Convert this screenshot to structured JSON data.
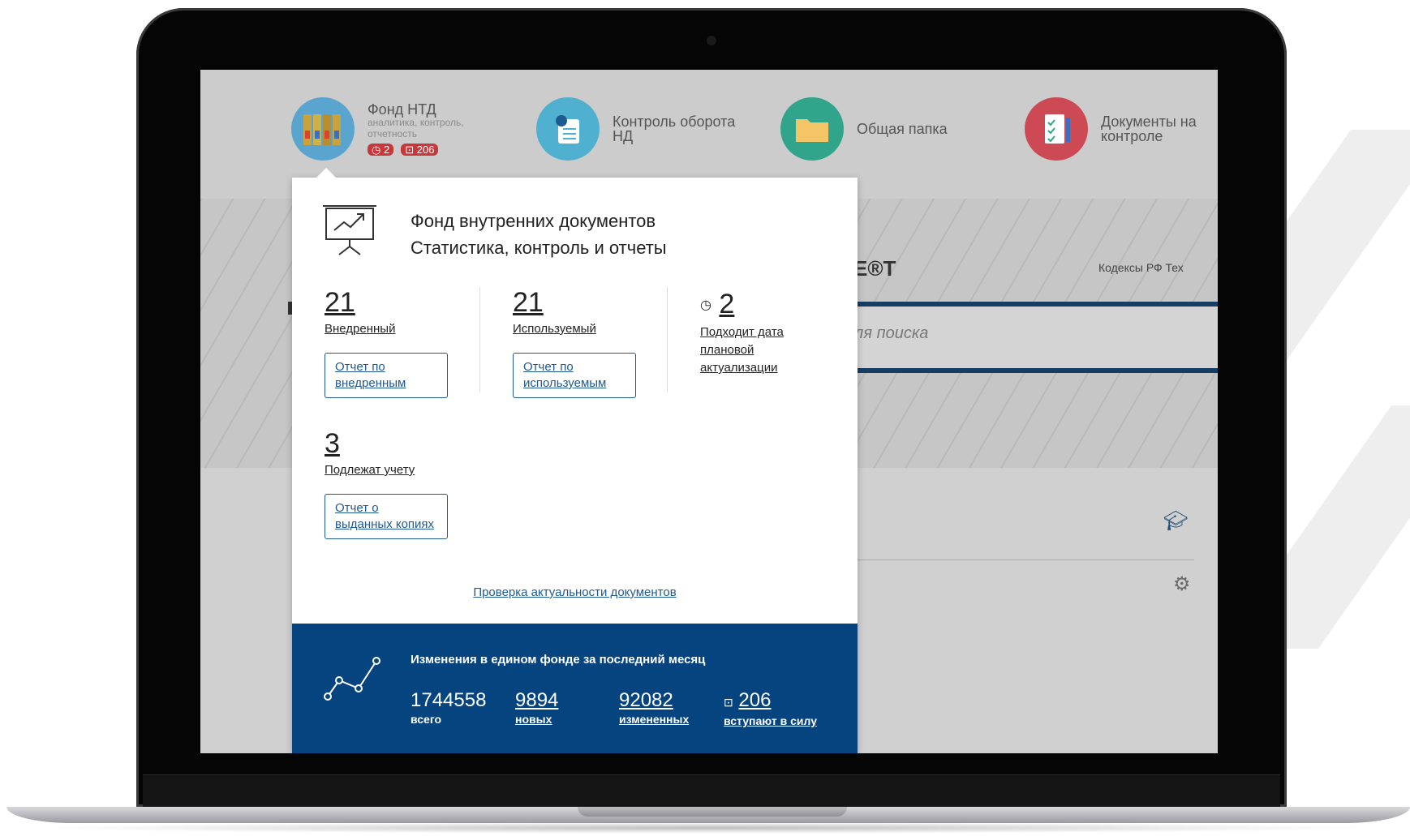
{
  "header": {
    "tiles": [
      {
        "icon": "binders-icon",
        "title": "Фонд НТД",
        "subtitle": "аналитика, контроль, отчетность",
        "badges": [
          "2",
          "206"
        ],
        "color": "#5aa5cf"
      },
      {
        "icon": "document-icon",
        "title": "Контроль оборота НД",
        "color": "#4fb0cf"
      },
      {
        "icon": "folder-icon",
        "title": "Общая папка",
        "color": "#30a58c"
      },
      {
        "icon": "checklist-icon",
        "title": "Документы на контроле",
        "color": "#cd4a54"
      }
    ]
  },
  "site": {
    "logo_fragment": "Е®Т",
    "nav_links": "Кодексы РФ   Тех",
    "search_placeholder": "для поиска"
  },
  "popup": {
    "title_line1": "Фонд внутренних документов",
    "title_line2": "Статистика, контроль и отчеты",
    "stats": [
      {
        "value": "21",
        "label": "Внедренный",
        "button": "Отчет по внедренным"
      },
      {
        "value": "21",
        "label": "Используемый",
        "button": "Отчет по используемым"
      },
      {
        "value": "2",
        "label": "Подходит дата плановой актуализации"
      },
      {
        "value": "3",
        "label": "Подлежат учету",
        "button": "Отчет о выданных копиях"
      }
    ],
    "check_link": "Проверка актуальности документов"
  },
  "changes": {
    "title": "Изменения в едином фонде за последний месяц",
    "items": [
      {
        "value": "1744558",
        "label": "всего"
      },
      {
        "value": "9894",
        "label": "новых"
      },
      {
        "value": "92082",
        "label": "измененных"
      },
      {
        "value": "206",
        "label": "вступают в силу"
      }
    ]
  },
  "colors": {
    "accent": "#1e5a91",
    "panel": "#064480",
    "badge": "#c8383a"
  }
}
